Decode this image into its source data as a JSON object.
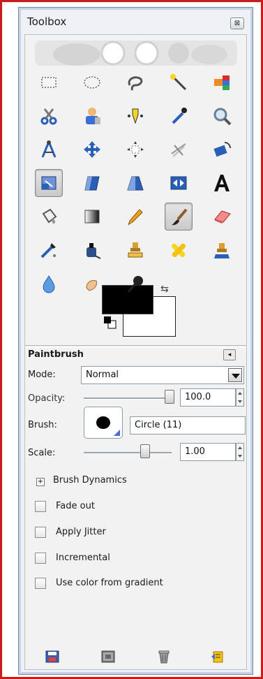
{
  "window": {
    "title": "Toolbox",
    "close_glyph": "⊠"
  },
  "tools": [
    {
      "name": "rect-select-tool-icon",
      "active": false
    },
    {
      "name": "ellipse-select-tool-icon",
      "active": false
    },
    {
      "name": "free-select-tool-icon",
      "active": false
    },
    {
      "name": "fuzzy-select-tool-icon",
      "active": false
    },
    {
      "name": "select-by-color-tool-icon",
      "active": false
    },
    {
      "name": "scissors-select-tool-icon",
      "active": false
    },
    {
      "name": "foreground-select-tool-icon",
      "active": false
    },
    {
      "name": "paths-tool-icon",
      "active": false
    },
    {
      "name": "color-picker-tool-icon",
      "active": false
    },
    {
      "name": "zoom-tool-icon",
      "active": false
    },
    {
      "name": "measure-tool-icon",
      "active": false
    },
    {
      "name": "move-tool-icon",
      "active": false
    },
    {
      "name": "align-tool-icon",
      "active": false
    },
    {
      "name": "crop-tool-icon",
      "active": false
    },
    {
      "name": "rotate-tool-icon",
      "active": false
    },
    {
      "name": "scale-tool-icon",
      "active": true
    },
    {
      "name": "shear-tool-icon",
      "active": false
    },
    {
      "name": "perspective-tool-icon",
      "active": false
    },
    {
      "name": "flip-tool-icon",
      "active": false
    },
    {
      "name": "text-tool-icon",
      "active": false
    },
    {
      "name": "bucket-fill-tool-icon",
      "active": false
    },
    {
      "name": "blend-tool-icon",
      "active": false
    },
    {
      "name": "pencil-tool-icon",
      "active": false
    },
    {
      "name": "paintbrush-tool-icon",
      "active": true
    },
    {
      "name": "eraser-tool-icon",
      "active": false
    },
    {
      "name": "airbrush-tool-icon",
      "active": false
    },
    {
      "name": "ink-tool-icon",
      "active": false
    },
    {
      "name": "clone-tool-icon",
      "active": false
    },
    {
      "name": "heal-tool-icon",
      "active": false
    },
    {
      "name": "perspective-clone-tool-icon",
      "active": false
    },
    {
      "name": "blur-sharpen-tool-icon",
      "active": false
    },
    {
      "name": "smudge-tool-icon",
      "active": false
    },
    {
      "name": "dodge-burn-tool-icon",
      "active": false
    }
  ],
  "colors": {
    "foreground": "#000000",
    "background": "#ffffff",
    "swap_glyph": "⇆"
  },
  "options": {
    "title": "Paintbrush",
    "menu_glyph": "◂",
    "mode_label": "Mode:",
    "mode_value": "Normal",
    "opacity_label": "Opacity:",
    "opacity_value": "100.0",
    "opacity_fraction": 1.0,
    "brush_label": "Brush:",
    "brush_value": "Circle (11)",
    "scale_label": "Scale:",
    "scale_value": "1.00",
    "scale_fraction": 0.7,
    "dynamics_label": "Brush Dynamics",
    "dynamics_glyph": "+",
    "checkboxes": [
      {
        "label": "Fade out",
        "checked": false
      },
      {
        "label": "Apply Jitter",
        "checked": false
      },
      {
        "label": "Incremental",
        "checked": false
      },
      {
        "label": "Use color from gradient",
        "checked": false
      }
    ]
  },
  "bottom_buttons": [
    "save-options-icon",
    "restore-options-icon",
    "delete-options-icon",
    "reset-options-icon"
  ]
}
